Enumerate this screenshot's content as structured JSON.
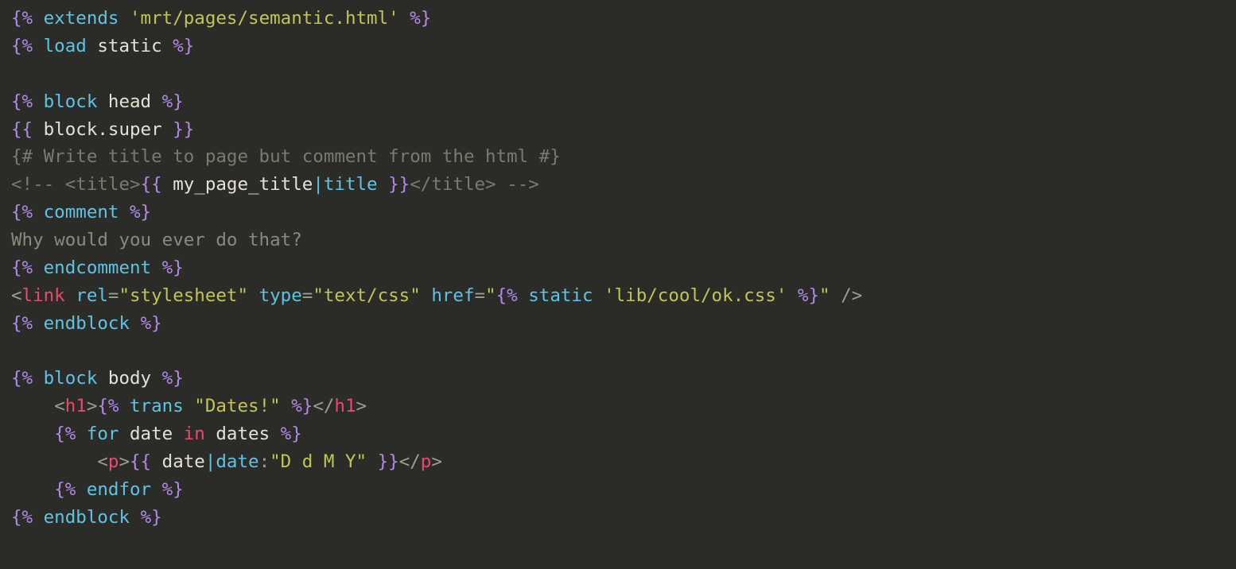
{
  "lines": {
    "l1": {
      "d1": "{%",
      "kw": "extends",
      "str": "'mrt/pages/semantic.html'",
      "d2": "%}"
    },
    "l2": {
      "d1": "{%",
      "kw": "load",
      "id": "static",
      "d2": "%}"
    },
    "l3": "",
    "l4": {
      "d1": "{%",
      "kw": "block",
      "id": "head",
      "d2": "%}"
    },
    "l5": {
      "d1": "{{",
      "id": "block.super",
      "d2": "}}"
    },
    "l6": {
      "text": "{# Write title to page but comment from the html #}"
    },
    "l7": {
      "c1": "<!-- <title>",
      "d1": "{{",
      "id": "my_page_title",
      "pipe": "|",
      "filt": "title",
      "d2": "}}",
      "c2": "</title> -->"
    },
    "l8": {
      "d1": "{%",
      "kw": "comment",
      "d2": "%}"
    },
    "l9": {
      "text": "Why would you ever do that?"
    },
    "l10": {
      "d1": "{%",
      "kw": "endcomment",
      "d2": "%}"
    },
    "l11": {
      "lt": "<",
      "tag": "link",
      "a1": "rel",
      "eq": "=",
      "v1": "\"stylesheet\"",
      "a2": "type",
      "v2": "\"text/css\"",
      "a3": "href",
      "q1": "\"",
      "td1": "{%",
      "tk": "static",
      "ts": "'lib/cool/ok.css'",
      "td2": "%}",
      "q2": "\"",
      "end": " />"
    },
    "l12": {
      "d1": "{%",
      "kw": "endblock",
      "d2": "%}"
    },
    "l13": "",
    "l14": {
      "d1": "{%",
      "kw": "block",
      "id": "body",
      "d2": "%}"
    },
    "l15": {
      "indent": "    ",
      "lt": "<",
      "tag": "h1",
      "gt": ">",
      "td1": "{%",
      "tk": "trans",
      "ts": "\"Dates!\"",
      "td2": "%}",
      "lt2": "</",
      "tag2": "h1",
      "gt2": ">"
    },
    "l16": {
      "indent": "    ",
      "d1": "{%",
      "kw": "for",
      "id": "date",
      "in": "in",
      "id2": "dates",
      "d2": "%}"
    },
    "l17": {
      "indent": "        ",
      "lt": "<",
      "tag": "p",
      "gt": ">",
      "vd1": "{{",
      "id": "date",
      "pipe": "|",
      "filt": "date",
      "colon": ":",
      "fs": "\"D d M Y\"",
      "vd2": "}}",
      "lt2": "</",
      "tag2": "p",
      "gt2": ">"
    },
    "l18": {
      "indent": "    ",
      "d1": "{%",
      "kw": "endfor",
      "d2": "%}"
    },
    "l19": {
      "d1": "{%",
      "kw": "endblock",
      "d2": "%}"
    }
  }
}
